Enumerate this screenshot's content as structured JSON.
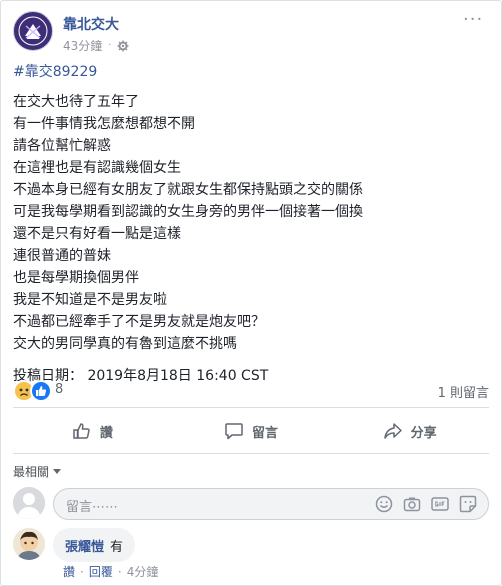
{
  "post": {
    "page_name": "靠北交大",
    "time": "43分鐘",
    "hashtag": "#靠交89229",
    "lines": [
      "在交大也待了五年了",
      "有一件事情我怎麼想都想不開",
      "請各位幫忙解惑",
      "在這裡也是有認識幾個女生",
      "不過本身已經有女朋友了就跟女生都保持點頭之交的關係",
      "可是我每學期看到認識的女生身旁的男伴一個接著一個換",
      "還不是只有好看一點是這樣",
      "連很普通的普妹",
      "也是每學期換個男伴",
      "我是不知道是不是男友啦",
      "不過都已經牽手了不是男友就是炮友吧？",
      "交大的男同學真的有魯到這麼不挑嗎"
    ],
    "post_time": "投稿日期： 2019年8月18日 16:40 CST"
  },
  "reactions": {
    "count": "8",
    "comment_count": "1 則留言"
  },
  "actions": {
    "like": "讚",
    "comment": "留言",
    "share": "分享"
  },
  "comments": {
    "filter_label": "最相關",
    "input_placeholder": "留言⋯⋯",
    "items": [
      {
        "author": "張耀愷",
        "text": "有",
        "like": "讚",
        "reply": "回覆",
        "time": "4分鐘"
      }
    ]
  },
  "colors": {
    "link": "#385898",
    "accent": "#1877f2",
    "muted": "#90949c"
  }
}
